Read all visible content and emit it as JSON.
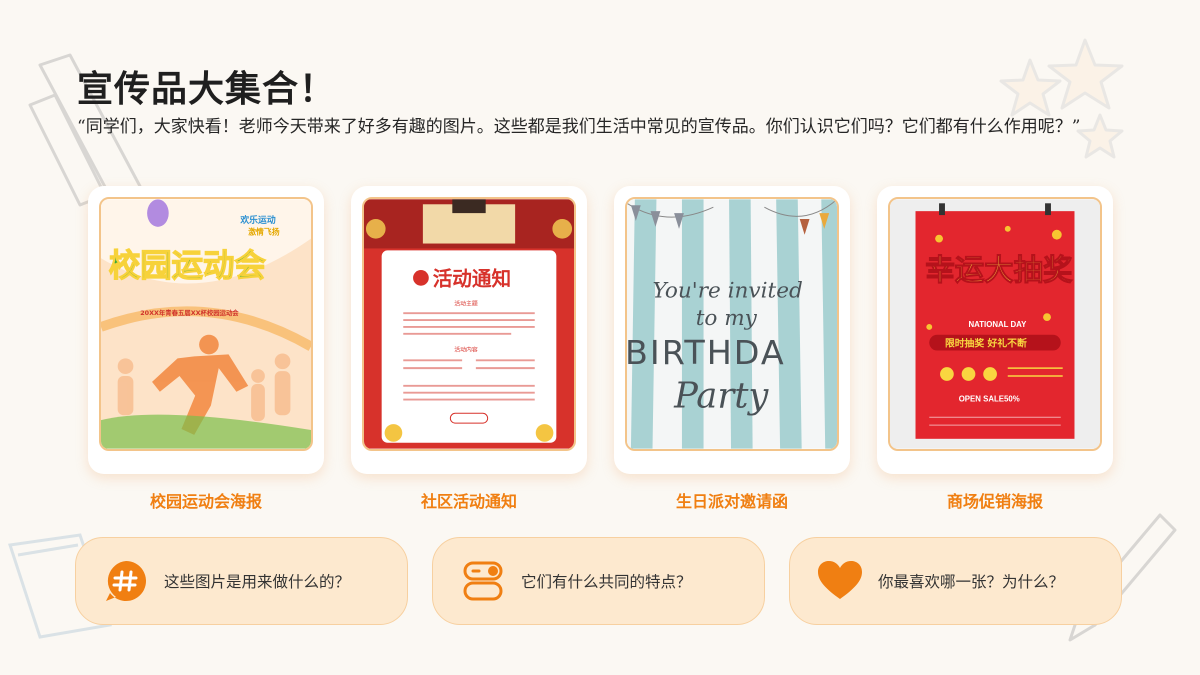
{
  "header": {
    "title": "宣传品大集合！",
    "intro": "“同学们，大家快看！老师今天带来了好多有趣的图片。这些都是我们生活中常见的宣传品。你们认识它们吗？它们都有什么作用呢？”"
  },
  "cards": [
    {
      "caption": "校园运动会海报",
      "image_text": [
        "欢乐运动",
        "激情飞扬",
        "校园运动会",
        "20XX年青春五届XX杯校园运动会"
      ]
    },
    {
      "caption": "社区活动通知",
      "image_text": [
        "活动通知",
        "活动主题",
        "活动内容"
      ]
    },
    {
      "caption": "生日派对邀请函",
      "image_text": [
        "You're invited",
        "to my",
        "BIRTHDA",
        "Party"
      ]
    },
    {
      "caption": "商场促销海报",
      "image_text": [
        "幸运大抽奖",
        "NATIONAL DAY",
        "限时抽奖 好礼不断",
        "OPEN SALE50%"
      ]
    }
  ],
  "questions": [
    {
      "icon": "hash-icon",
      "text": "这些图片是用来做什么的？"
    },
    {
      "icon": "toggle-icon",
      "text": "它们有什么共同的特点？"
    },
    {
      "icon": "heart-icon",
      "text": "你最喜欢哪一张？为什么？"
    }
  ],
  "colors": {
    "accent": "#f07f12",
    "card_border": "#f3c48a",
    "question_bg": "#fde9cf",
    "background": "#fbf8f3"
  }
}
